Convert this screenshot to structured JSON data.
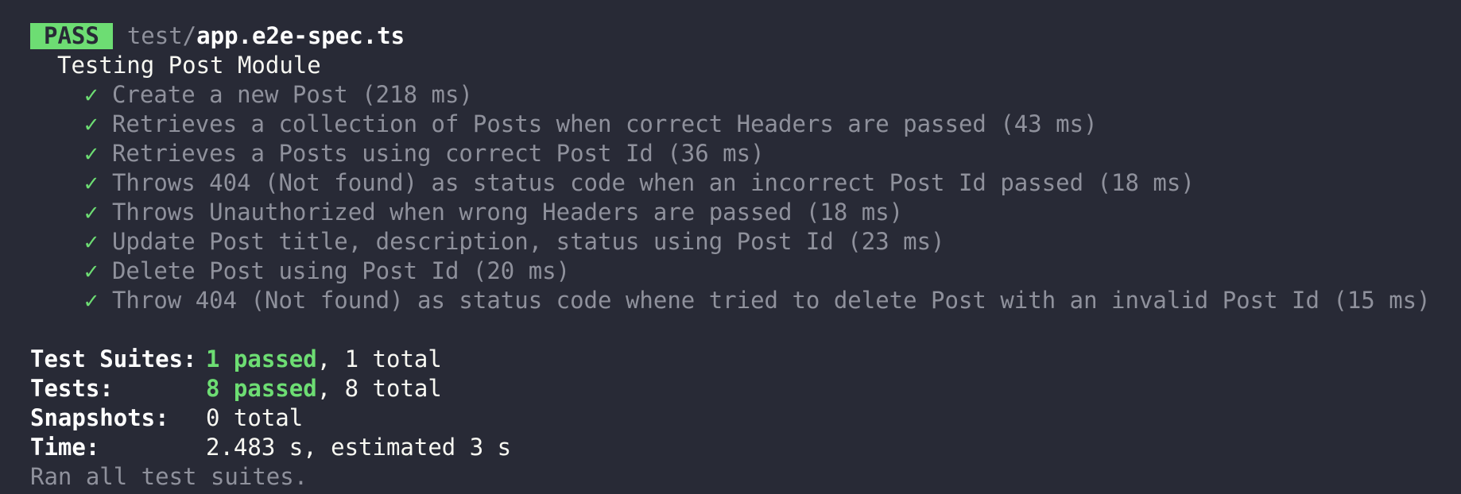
{
  "header": {
    "status_badge": "PASS",
    "file_dir": "test/",
    "file_name": "app.e2e-spec.ts"
  },
  "suite": {
    "name": "Testing Post Module",
    "check_symbol": "✓",
    "tests": [
      "Create a new Post (218 ms)",
      "Retrieves a collection of Posts when correct Headers are passed (43 ms)",
      "Retrieves a Posts using correct Post Id (36 ms)",
      "Throws 404 (Not found) as status code when an incorrect Post Id passed (18 ms)",
      "Throws Unauthorized when wrong Headers are passed (18 ms)",
      "Update Post title, description, status using Post Id (23 ms)",
      "Delete Post using Post Id (20 ms)",
      "Throw 404 (Not found) as status code whene tried to delete Post with an invalid Post Id (15 ms)"
    ]
  },
  "summary": {
    "suites_label": "Test Suites:",
    "suites_passed": "1 passed",
    "suites_total": ", 1 total",
    "tests_label": "Tests:",
    "tests_passed": "8 passed",
    "tests_total": ", 8 total",
    "snapshots_label": "Snapshots:",
    "snapshots_value": "0 total",
    "time_label": "Time:",
    "time_value": "2.483 s, estimated 3 s",
    "footer": "Ran all test suites."
  },
  "colors": {
    "background": "#282a36",
    "pass_green": "#6ddd73",
    "dim_text": "#8f919c",
    "bright_text": "#ffffff"
  }
}
